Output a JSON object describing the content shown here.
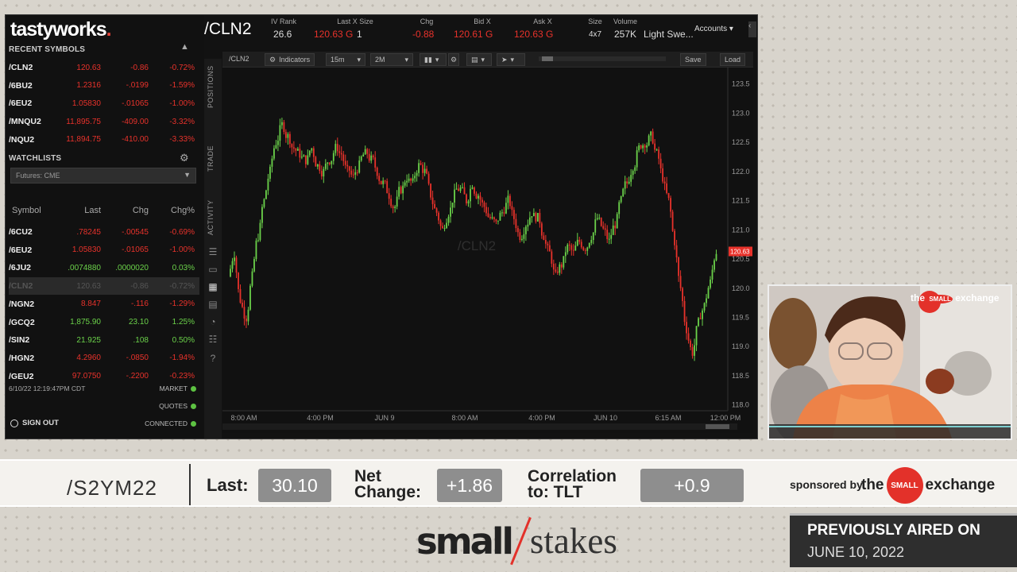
{
  "header": {
    "logo": "tastyworks",
    "logo_dot": ".",
    "symbol": "/CLN2",
    "stats": [
      {
        "label": "IV Rank",
        "value": "26.6"
      },
      {
        "label": "Last X Size",
        "value": "120.63 G",
        "extra": "1"
      },
      {
        "label": "Chg",
        "value": "-0.88"
      },
      {
        "label": "Bid X",
        "value": "120.61 G"
      },
      {
        "label": "Ask X",
        "value": "120.63 G"
      },
      {
        "label": "Size",
        "value": "4x7"
      },
      {
        "label": "Volume",
        "value": "257K"
      }
    ],
    "description": "Light Swe...",
    "accounts_label": "Accounts"
  },
  "recent": {
    "title": "RECENT SYMBOLS",
    "rows": [
      {
        "sym": "/CLN2",
        "last": "120.63",
        "chg": "-0.86",
        "pct": "-0.72%",
        "color": "red"
      },
      {
        "sym": "/6BU2",
        "last": "1.2316",
        "chg": "-.0199",
        "pct": "-1.59%",
        "color": "red"
      },
      {
        "sym": "/6EU2",
        "last": "1.05830",
        "chg": "-.01065",
        "pct": "-1.00%",
        "color": "red"
      },
      {
        "sym": "/MNQU2",
        "last": "11,895.75",
        "chg": "-409.00",
        "pct": "-3.32%",
        "color": "red"
      },
      {
        "sym": "/NQU2",
        "last": "11,894.75",
        "chg": "-410.00",
        "pct": "-3.33%",
        "color": "red"
      }
    ]
  },
  "watchlists": {
    "title": "WATCHLISTS",
    "selected": "Futures: CME",
    "columns": [
      "Symbol",
      "Last",
      "Chg",
      "Chg%"
    ],
    "rows": [
      {
        "sym": "/6CU2",
        "last": ".78245",
        "chg": "-.00545",
        "pct": "-0.69%",
        "color": "red"
      },
      {
        "sym": "/6EU2",
        "last": "1.05830",
        "chg": "-.01065",
        "pct": "-1.00%",
        "color": "red"
      },
      {
        "sym": "/6JU2",
        "last": ".0074880",
        "chg": ".0000020",
        "pct": "0.03%",
        "color": "green"
      },
      {
        "sym": "/CLN2",
        "last": "120.63",
        "chg": "-0.86",
        "pct": "-0.72%",
        "color": "red",
        "selected": true
      },
      {
        "sym": "/NGN2",
        "last": "8.847",
        "chg": "-.116",
        "pct": "-1.29%",
        "color": "red"
      },
      {
        "sym": "/GCQ2",
        "last": "1,875.90",
        "chg": "23.10",
        "pct": "1.25%",
        "color": "green"
      },
      {
        "sym": "/SIN2",
        "last": "21.925",
        "chg": ".108",
        "pct": "0.50%",
        "color": "green"
      },
      {
        "sym": "/HGN2",
        "last": "4.2960",
        "chg": "-.0850",
        "pct": "-1.94%",
        "color": "red"
      },
      {
        "sym": "/GEU2",
        "last": "97.0750",
        "chg": "-.2200",
        "pct": "-0.23%",
        "color": "red"
      }
    ],
    "timestamp": "6/10/22 12:19:47PM CDT",
    "status": [
      "MARKET",
      "QUOTES",
      "CONNECTED"
    ],
    "sign_out": "SIGN OUT"
  },
  "tabs": [
    "POSITIONS",
    "TRADE",
    "ACTIVITY"
  ],
  "toolbar": {
    "symbol": "/CLN2",
    "indicators": "Indicators",
    "interval": "15m",
    "range": "2M",
    "save": "Save",
    "load": "Load"
  },
  "chart_data": {
    "type": "candlestick",
    "watermark": "/CLN2",
    "y_ticks": [
      "123.5",
      "123.0",
      "122.5",
      "122.0",
      "121.5",
      "121.0",
      "120.5",
      "120.0",
      "119.5",
      "119.0",
      "118.5",
      "118.0"
    ],
    "x_ticks": [
      "8:00 AM",
      "4:00 PM",
      "JUN 9",
      "8:00 AM",
      "4:00 PM",
      "JUN 10",
      "6:15 AM",
      "12:00 PM"
    ],
    "ylim": [
      117.9,
      123.7
    ],
    "last_price": "120.63",
    "closes": [
      120.6,
      119.8,
      119.5,
      120.2,
      120.9,
      121.5,
      122.0,
      122.5,
      122.8,
      122.6,
      122.4,
      122.3,
      122.2,
      122.4,
      122.1,
      122.0,
      122.2,
      122.4,
      122.3,
      122.0,
      121.9,
      122.1,
      122.3,
      122.2,
      122.0,
      121.8,
      121.6,
      121.4,
      121.7,
      121.9,
      121.8,
      122.1,
      122.0,
      121.6,
      121.3,
      121.0,
      121.3,
      121.6,
      121.7,
      121.5,
      121.8,
      121.6,
      121.4,
      121.2,
      121.1,
      121.3,
      121.5,
      121.2,
      120.9,
      121.1,
      121.3,
      121.2,
      120.9,
      120.6,
      120.2,
      120.4,
      120.7,
      120.6,
      120.8,
      120.7,
      120.9,
      121.2,
      121.0,
      120.8,
      121.1,
      121.5,
      121.8,
      122.1,
      122.4,
      122.5,
      122.6,
      122.3,
      121.9,
      121.5,
      120.8,
      120.0,
      119.3,
      118.9,
      119.4,
      119.7,
      120.1,
      120.63
    ]
  },
  "lowerbar": {
    "ticker": "/S2YM22",
    "last_label": "Last:",
    "last_value": "30.10",
    "net_label_1": "Net",
    "net_label_2": "Change:",
    "net_value": "+1.86",
    "corr_label_1": "Correlation",
    "corr_label_2": "to: TLT",
    "corr_value": "+0.9",
    "sponsor_by": "sponsored by",
    "sponsor_the": "the",
    "sponsor_small": "SMALL",
    "sponsor_exchange": "exchange"
  },
  "show": {
    "title_left": "small",
    "title_right": "stakes",
    "aired_1": "PREVIOUSLY AIRED ON",
    "aired_2": "JUNE 10, 2022"
  },
  "webcam": {
    "banner_the": "the",
    "banner_small": "SMALL",
    "banner_exchange": "exchange"
  }
}
